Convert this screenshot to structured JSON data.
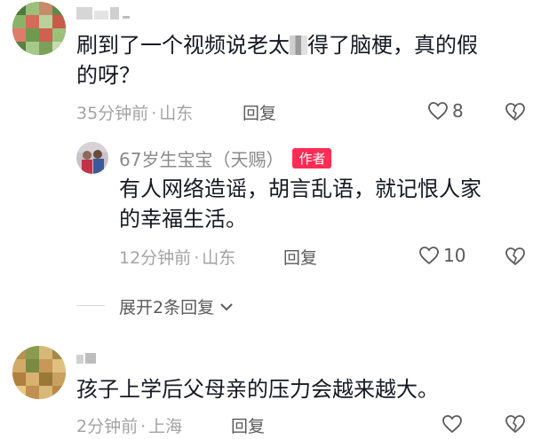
{
  "comments": [
    {
      "username": "",
      "text_line1": "刷到了一个视频说老太",
      "text_line1b": "得了脑梗，真的假",
      "text_line2": "的呀？",
      "time": "35分钟前",
      "location": "山东",
      "reply_label": "回复",
      "likes": "8"
    },
    {
      "username": "",
      "text": "孩子上学后父母亲的压力会越来越大。",
      "time": "2分钟前",
      "location": "上海",
      "reply_label": "回复"
    }
  ],
  "reply": {
    "username": "67岁生宝宝（天赐）",
    "badge": "作者",
    "text_line1": "有人网络造谣，胡言乱语，就记恨人家",
    "text_line2": "的幸福生活。",
    "time": "12分钟前",
    "location": "山东",
    "reply_label": "回复",
    "likes": "10"
  },
  "expand_label": "展开2条回复",
  "meta_sep": "·",
  "icons": {
    "like": "heart-outline-icon",
    "dislike": "broken-heart-icon",
    "expand": "chevron-down-icon"
  },
  "colors": {
    "author_badge": "#ff2c55",
    "meta": "#a3a3a3"
  }
}
